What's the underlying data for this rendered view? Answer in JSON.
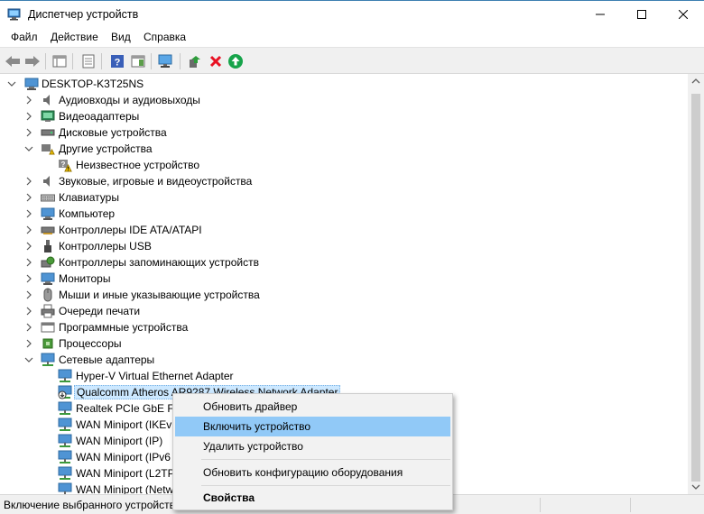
{
  "window": {
    "title": "Диспетчер устройств"
  },
  "menu": [
    "Файл",
    "Действие",
    "Вид",
    "Справка"
  ],
  "tree": {
    "root": "DESKTOP-K3T25NS",
    "items": [
      {
        "label": "Аудиовходы и аудиовыходы",
        "icon": "speaker-icon"
      },
      {
        "label": "Видеоадаптеры",
        "icon": "display-adapter-icon"
      },
      {
        "label": "Дисковые устройства",
        "icon": "disk-drive-icon"
      },
      {
        "label": "Другие устройства",
        "icon": "other-devices-icon",
        "expanded": true,
        "children": [
          {
            "label": "Неизвестное устройство",
            "icon": "unknown-device-warning-icon"
          }
        ]
      },
      {
        "label": "Звуковые, игровые и видеоустройства",
        "icon": "sound-icon"
      },
      {
        "label": "Клавиатуры",
        "icon": "keyboard-icon"
      },
      {
        "label": "Компьютер",
        "icon": "computer-icon"
      },
      {
        "label": "Контроллеры IDE ATA/ATAPI",
        "icon": "ide-controller-icon"
      },
      {
        "label": "Контроллеры USB",
        "icon": "usb-icon"
      },
      {
        "label": "Контроллеры запоминающих устройств",
        "icon": "storage-controller-icon"
      },
      {
        "label": "Мониторы",
        "icon": "monitor-icon"
      },
      {
        "label": "Мыши и иные указывающие устройства",
        "icon": "mouse-icon"
      },
      {
        "label": "Очереди печати",
        "icon": "printer-icon"
      },
      {
        "label": "Программные устройства",
        "icon": "software-device-icon"
      },
      {
        "label": "Процессоры",
        "icon": "processor-icon"
      },
      {
        "label": "Сетевые адаптеры",
        "icon": "network-adapter-icon",
        "expanded": true,
        "children": [
          {
            "label": "Hyper-V Virtual Ethernet Adapter",
            "icon": "network-adapter-icon"
          },
          {
            "label": "Qualcomm Atheros AR9287 Wireless Network Adapter",
            "icon": "network-adapter-disabled-icon",
            "selected": true
          },
          {
            "label": "Realtek PCIe GbE Fa",
            "icon": "network-adapter-icon"
          },
          {
            "label": "WAN Miniport (IKEv",
            "icon": "network-adapter-icon"
          },
          {
            "label": "WAN Miniport (IP)",
            "icon": "network-adapter-icon"
          },
          {
            "label": "WAN Miniport (IPv6",
            "icon": "network-adapter-icon"
          },
          {
            "label": "WAN Miniport (L2TP",
            "icon": "network-adapter-icon"
          },
          {
            "label": "WAN Miniport (Netw",
            "icon": "network-adapter-icon"
          }
        ]
      }
    ]
  },
  "context_menu": {
    "items": [
      "Обновить драйвер",
      "Включить устройство",
      "Удалить устройство",
      "Обновить конфигурацию оборудования",
      "Свойства"
    ],
    "highlighted": "Включить устройство",
    "default": "Свойства"
  },
  "status": {
    "text": "Включение выбранного устройства."
  },
  "colors": {
    "selection": "#cce8ff",
    "menu_highlight": "#91c9f7",
    "remove_red": "#e81123",
    "enable_green": "#16a34a"
  }
}
